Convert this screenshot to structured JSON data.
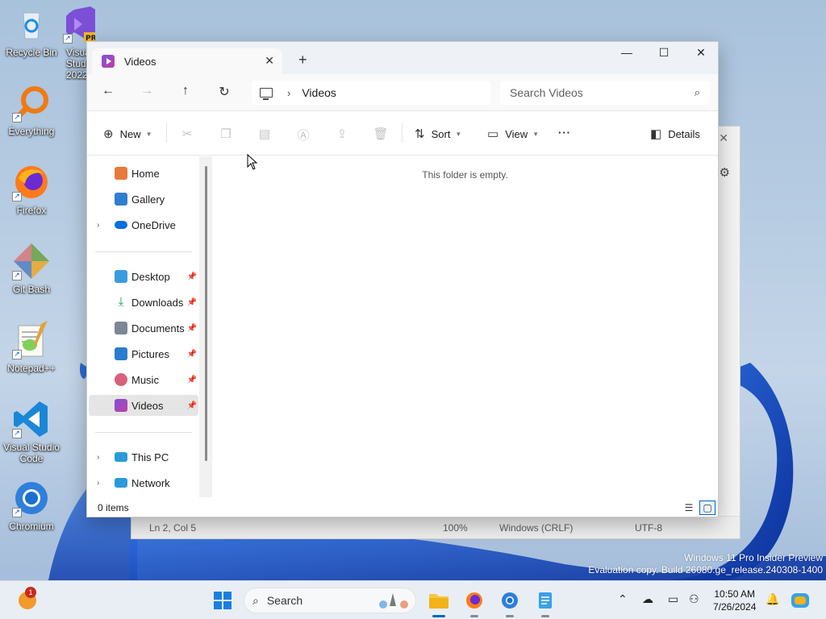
{
  "desktop": {
    "icons": [
      {
        "id": "recycle",
        "label": "Recycle Bin",
        "icon": "recycle-bin-icon"
      },
      {
        "id": "vs2022",
        "label": "Visual Studio 2022",
        "badge": "PRE",
        "icon": "visual-studio-icon"
      },
      {
        "id": "everything",
        "label": "Everything",
        "icon": "everything-search-icon"
      },
      {
        "id": "firefox",
        "label": "Firefox",
        "icon": "firefox-icon"
      },
      {
        "id": "gitbash",
        "label": "Git Bash",
        "icon": "git-bash-icon"
      },
      {
        "id": "notepadpp",
        "label": "Notepad++",
        "icon": "notepad-plus-plus-icon"
      },
      {
        "id": "vscode",
        "label": "Visual Studio Code",
        "icon": "vscode-icon"
      },
      {
        "id": "chromium",
        "label": "Chromium",
        "icon": "chromium-icon"
      }
    ]
  },
  "notepad_background": {
    "status": {
      "position": "Ln 2, Col 5",
      "zoom": "100%",
      "line_ending": "Windows (CRLF)",
      "encoding": "UTF-8"
    }
  },
  "explorer": {
    "tab_title": "Videos",
    "address": {
      "root_icon": "this-pc-icon",
      "separator": "›",
      "crumb": "Videos"
    },
    "search_placeholder": "Search Videos",
    "toolbar": {
      "new_label": "New",
      "sort_label": "Sort",
      "view_label": "View",
      "more_label": "···",
      "details_label": "Details"
    },
    "sidebar": {
      "quick": [
        {
          "label": "Home",
          "icon": "home-icon",
          "color": "#e8793a"
        },
        {
          "label": "Gallery",
          "icon": "gallery-icon",
          "color": "#2f7fd0"
        },
        {
          "label": "OneDrive",
          "icon": "onedrive-icon",
          "color": "#0a6fd8",
          "expandable": true
        }
      ],
      "pinned": [
        {
          "label": "Desktop",
          "icon": "desktop-folder-icon",
          "color": "#3a9be0"
        },
        {
          "label": "Downloads",
          "icon": "downloads-icon",
          "color": "#1f9d55"
        },
        {
          "label": "Documents",
          "icon": "documents-icon",
          "color": "#7b8794"
        },
        {
          "label": "Pictures",
          "icon": "pictures-icon",
          "color": "#2b7ccf"
        },
        {
          "label": "Music",
          "icon": "music-icon",
          "color": "#d7607a"
        },
        {
          "label": "Videos",
          "icon": "videos-icon",
          "color": "#8a4fd1",
          "active": true
        }
      ],
      "locations": [
        {
          "label": "This PC",
          "icon": "this-pc-icon",
          "color": "#2a9bd8"
        },
        {
          "label": "Network",
          "icon": "network-icon",
          "color": "#2a9bd8"
        }
      ]
    },
    "content": {
      "empty_message": "This folder is empty."
    },
    "status": {
      "item_count": "0 items"
    }
  },
  "watermark": {
    "line1": "Windows 11 Pro Insider Preview",
    "line2": "Evaluation copy. Build 26080.ge_release.240308-1400"
  },
  "taskbar": {
    "search_label": "Search",
    "notification_count": "1",
    "clock_time": "10:50 AM",
    "clock_date": "7/26/2024",
    "accent": "#0067c0"
  }
}
